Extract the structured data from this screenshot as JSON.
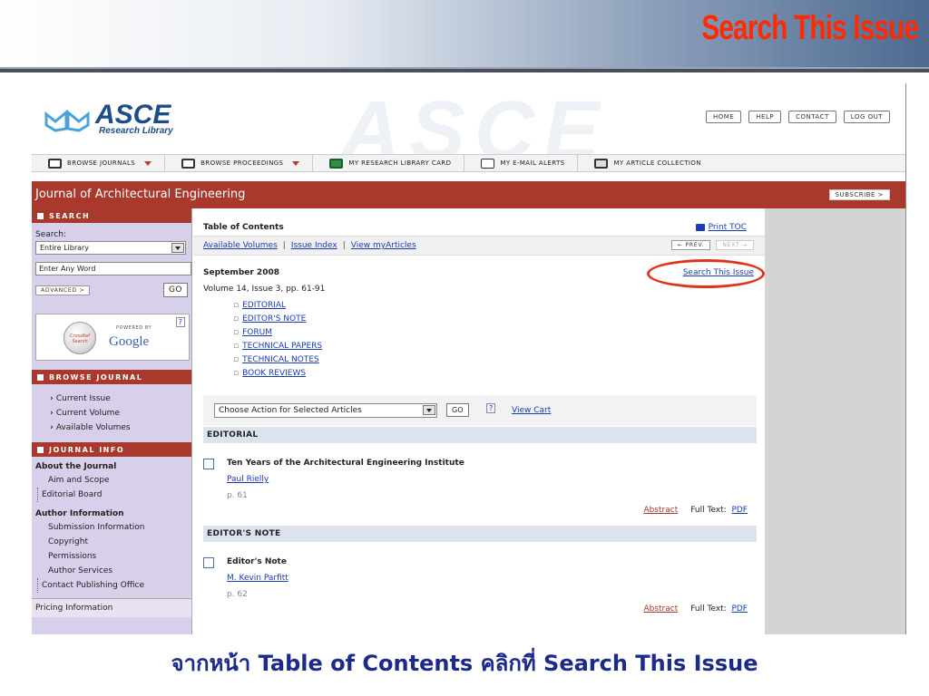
{
  "slide": {
    "title": "Search This Issue",
    "caption": "จากหน้า Table of Contents คลิกที่ Search This Issue",
    "title_color": "#ff2a00",
    "caption_color": "#1c2a8c"
  },
  "site": {
    "logo_text": "ASCE",
    "logo_sub": "Research Library",
    "top_buttons": [
      "HOME",
      "HELP",
      "CONTACT",
      "LOG OUT"
    ],
    "nav_items": [
      {
        "label": "BROWSE JOURNALS",
        "icon": "journal-icon",
        "dropdown": true
      },
      {
        "label": "BROWSE PROCEEDINGS",
        "icon": "proceedings-icon",
        "dropdown": true
      },
      {
        "label": "MY RESEARCH LIBRARY CARD",
        "icon": "library-card-icon",
        "dropdown": false
      },
      {
        "label": "MY E-MAIL ALERTS",
        "icon": "email-icon",
        "dropdown": false
      },
      {
        "label": "MY ARTICLE COLLECTION",
        "icon": "printer-icon",
        "dropdown": false
      }
    ],
    "journal_title": "Journal of Architectural Engineering",
    "subscribe": "SUBSCRIBE  >",
    "accent_color": "#a8392c"
  },
  "sidebar": {
    "search_head": "SEARCH",
    "search_label": "Search:",
    "scope_value": "Entire Library",
    "word_placeholder": "Enter Any Word",
    "advanced": "ADVANCED  >",
    "go": "GO",
    "powered_by": "POWERED BY",
    "google": "Google",
    "browse_head": "BROWSE JOURNAL",
    "browse_items": [
      "Current Issue",
      "Current Volume",
      "Available Volumes"
    ],
    "info_head": "JOURNAL INFO",
    "about_head": "About the Journal",
    "about_items": [
      "Aim and Scope",
      "Editorial Board"
    ],
    "author_head": "Author Information",
    "author_items": [
      "Submission Information",
      "Copyright",
      "Permissions",
      "Author Services",
      "Contact Publishing Office"
    ],
    "pricing": "Pricing Information"
  },
  "main": {
    "toc_head": "Table of Contents",
    "print_toc": "Print TOC",
    "links": [
      "Available Volumes",
      "Issue Index",
      "View myArticles"
    ],
    "prev": "← PREV.",
    "next": "NEXT →",
    "issue_date": "September 2008",
    "volume": "Volume 14, Issue 3, pp. 61-91",
    "search_issue": "Search This Issue",
    "sections": [
      "EDITORIAL",
      "EDITOR'S NOTE",
      "FORUM",
      "TECHNICAL PAPERS",
      "TECHNICAL NOTES",
      "BOOK REVIEWS"
    ],
    "action_select": "Choose Action for Selected Articles",
    "action_go": "GO",
    "view_cart": "View Cart",
    "groups": [
      {
        "section": "EDITORIAL",
        "title": "Ten Years of the Architectural Engineering Institute",
        "author": "Paul Rielly",
        "page": "p. 61"
      },
      {
        "section": "EDITOR'S NOTE",
        "title": "Editor's Note",
        "author": "M. Kevin Parfitt",
        "page": "p. 62"
      }
    ],
    "abstract_label": "Abstract",
    "fulltext_label": "Full Text:",
    "pdf_label": "PDF"
  }
}
